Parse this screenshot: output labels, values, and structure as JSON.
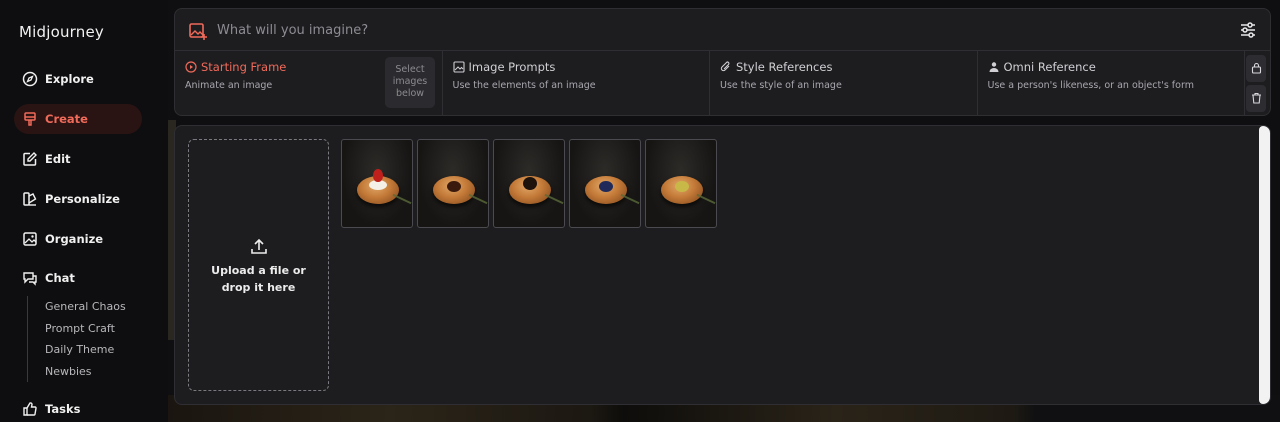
{
  "app": {
    "name": "Midjourney"
  },
  "sidebar": {
    "items": [
      {
        "label": "Explore",
        "icon": "compass-icon"
      },
      {
        "label": "Create",
        "icon": "brush-icon",
        "active": true
      },
      {
        "label": "Edit",
        "icon": "edit-icon"
      },
      {
        "label": "Personalize",
        "icon": "palette-icon"
      },
      {
        "label": "Organize",
        "icon": "image-folder-icon"
      },
      {
        "label": "Chat",
        "icon": "chat-icon"
      },
      {
        "label": "Tasks",
        "icon": "thumbs-up-icon"
      }
    ],
    "chat_rooms": [
      "General Chaos",
      "Prompt Craft",
      "Daily Theme",
      "Newbies"
    ]
  },
  "prompt": {
    "placeholder": "What will you imagine?",
    "value": ""
  },
  "tabs": [
    {
      "title": "Starting Frame",
      "desc": "Animate an image",
      "icon": "play-circle-icon",
      "active": true
    },
    {
      "title": "Image Prompts",
      "desc": "Use the elements of an image",
      "icon": "image-icon"
    },
    {
      "title": "Style References",
      "desc": "Use the style of an image",
      "icon": "paperclip-icon"
    },
    {
      "title": "Omni Reference",
      "desc": "Use a person's likeness, or an object's form",
      "icon": "person-icon"
    }
  ],
  "select_hint": "Select images below",
  "upload": {
    "text": "Upload a file or drop it here"
  },
  "thumbnails": [
    {
      "name": "strawberry-cream-bun",
      "topping": "strawberry"
    },
    {
      "name": "chocolate-bun",
      "topping": "chocolate"
    },
    {
      "name": "chocolate-truffle-bun",
      "topping": "dark-chocolate"
    },
    {
      "name": "blueberry-bun",
      "topping": "blueberry"
    },
    {
      "name": "pistachio-bun",
      "topping": "pistachio"
    }
  ],
  "colors": {
    "accent": "#f06a5a",
    "panel": "#1d1d20",
    "background": "#0f0f11"
  }
}
